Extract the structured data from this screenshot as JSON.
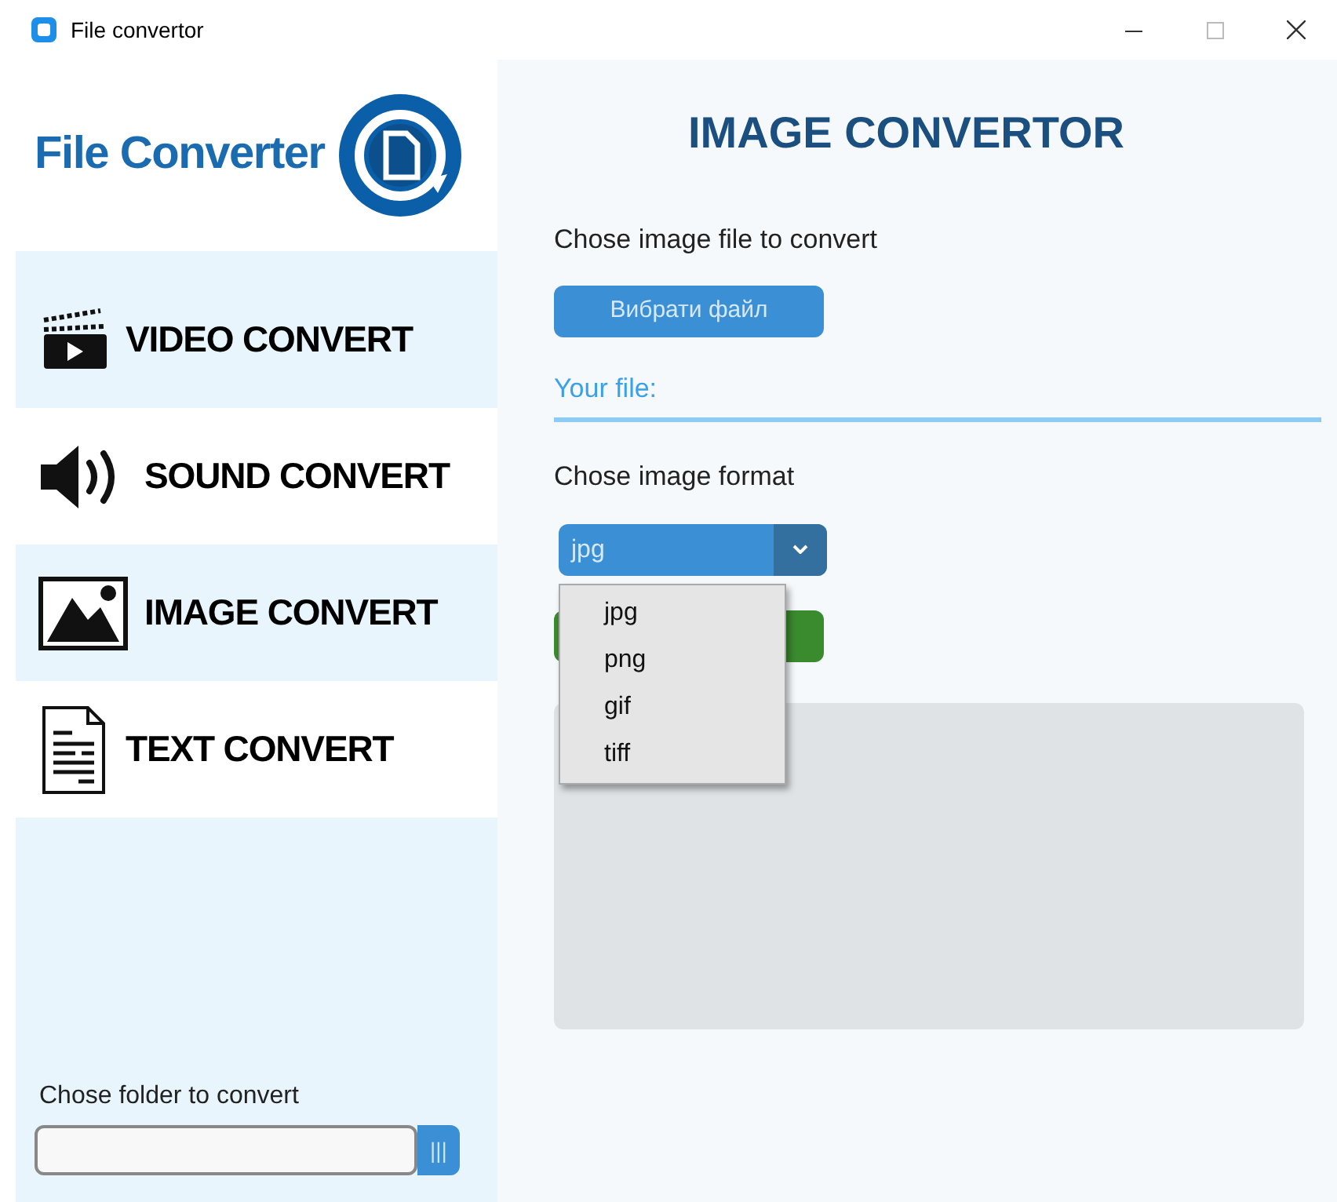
{
  "window": {
    "title": "File convertor"
  },
  "sidebar": {
    "logo_text": "File Converter",
    "items": [
      {
        "label": "VIDEO CONVERT",
        "kind": "video"
      },
      {
        "label": "SOUND CONVERT",
        "kind": "sound"
      },
      {
        "label": "IMAGE CONVERT",
        "kind": "image"
      },
      {
        "label": "TEXT CONVERT",
        "kind": "text"
      }
    ],
    "folder": {
      "label": "Chose folder to convert",
      "browse_button": "|||"
    }
  },
  "main": {
    "title": "IMAGE CONVERTOR",
    "file_label": "Chose image file to convert",
    "choose_button": "Вибрати файл",
    "your_file": "Your file:",
    "format_label": "Chose image format",
    "format_select": {
      "value": "jpg",
      "expanded": true,
      "options": [
        "jpg",
        "png",
        "gif",
        "tiff"
      ]
    }
  }
}
